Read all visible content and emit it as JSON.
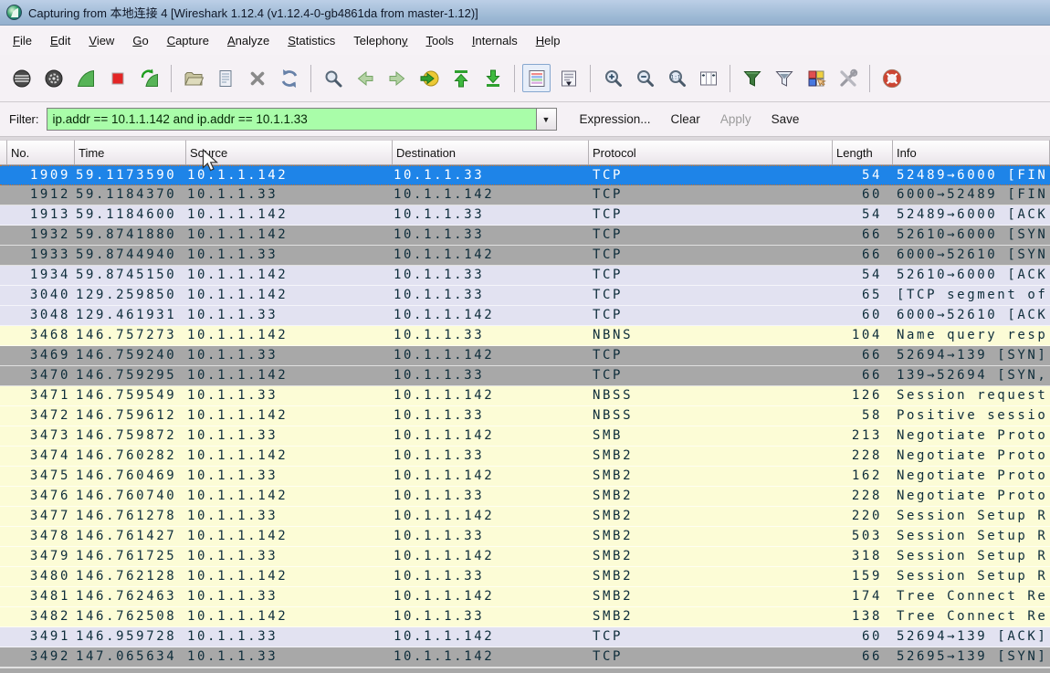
{
  "window": {
    "title": "Capturing from 本地连接 4    [Wireshark 1.12.4  (v1.12.4-0-gb4861da from master-1.12)]",
    "app_icon": "wireshark-logo"
  },
  "menubar": {
    "items": [
      {
        "label": "File",
        "underline": 0
      },
      {
        "label": "Edit",
        "underline": 0
      },
      {
        "label": "View",
        "underline": 0
      },
      {
        "label": "Go",
        "underline": 0
      },
      {
        "label": "Capture",
        "underline": 0
      },
      {
        "label": "Analyze",
        "underline": 0
      },
      {
        "label": "Statistics",
        "underline": 0
      },
      {
        "label": "Telephony",
        "underline": 8
      },
      {
        "label": "Tools",
        "underline": 0
      },
      {
        "label": "Internals",
        "underline": 0
      },
      {
        "label": "Help",
        "underline": 0
      }
    ]
  },
  "toolbar": {
    "groups": [
      [
        "interface-list",
        "capture-options",
        "capture-start",
        "capture-stop",
        "capture-restart"
      ],
      [
        "file-open",
        "file-save",
        "file-close",
        "reload"
      ],
      [
        "find-packet",
        "go-back",
        "go-forward",
        "go-to-packet",
        "go-to-top",
        "go-to-bottom"
      ],
      [
        "colorize",
        "auto-scroll"
      ],
      [
        "zoom-in",
        "zoom-out",
        "zoom-actual",
        "resize-columns"
      ],
      [
        "capture-filters",
        "display-filters",
        "coloring-rules",
        "preferences"
      ],
      [
        "help"
      ]
    ],
    "active_tool": "colorize"
  },
  "filter_bar": {
    "label": "Filter:",
    "value": "ip.addr == 10.1.1.142 and ip.addr == 10.1.1.33",
    "buttons": [
      {
        "label": "Expression...",
        "enabled": true
      },
      {
        "label": "Clear",
        "enabled": true
      },
      {
        "label": "Apply",
        "enabled": false
      },
      {
        "label": "Save",
        "enabled": true
      }
    ]
  },
  "packet_list": {
    "columns": [
      "No.",
      "Time",
      "Source",
      "Destination",
      "Protocol",
      "Length",
      "Info"
    ],
    "rows": [
      {
        "no": "1909",
        "time": "59.1173590",
        "source": "10.1.1.142",
        "destination": "10.1.1.33",
        "protocol": "TCP",
        "length": "54",
        "info": "52489→6000 [FIN",
        "color": "selected"
      },
      {
        "no": "1912",
        "time": "59.1184370",
        "source": "10.1.1.33",
        "destination": "10.1.1.142",
        "protocol": "TCP",
        "length": "60",
        "info": "6000→52489 [FIN",
        "color": "gray"
      },
      {
        "no": "1913",
        "time": "59.1184600",
        "source": "10.1.1.142",
        "destination": "10.1.1.33",
        "protocol": "TCP",
        "length": "54",
        "info": "52489→6000 [ACK",
        "color": "lavender"
      },
      {
        "no": "1932",
        "time": "59.8741880",
        "source": "10.1.1.142",
        "destination": "10.1.1.33",
        "protocol": "TCP",
        "length": "66",
        "info": "52610→6000 [SYN",
        "color": "gray"
      },
      {
        "no": "1933",
        "time": "59.8744940",
        "source": "10.1.1.33",
        "destination": "10.1.1.142",
        "protocol": "TCP",
        "length": "66",
        "info": "6000→52610 [SYN",
        "color": "gray"
      },
      {
        "no": "1934",
        "time": "59.8745150",
        "source": "10.1.1.142",
        "destination": "10.1.1.33",
        "protocol": "TCP",
        "length": "54",
        "info": "52610→6000 [ACK",
        "color": "lavender"
      },
      {
        "no": "3040",
        "time": "129.259850",
        "source": "10.1.1.142",
        "destination": "10.1.1.33",
        "protocol": "TCP",
        "length": "65",
        "info": "[TCP segment of",
        "color": "lavender"
      },
      {
        "no": "3048",
        "time": "129.461931",
        "source": "10.1.1.33",
        "destination": "10.1.1.142",
        "protocol": "TCP",
        "length": "60",
        "info": "6000→52610 [ACK",
        "color": "lavender"
      },
      {
        "no": "3468",
        "time": "146.757273",
        "source": "10.1.1.142",
        "destination": "10.1.1.33",
        "protocol": "NBNS",
        "length": "104",
        "info": "Name query resp",
        "color": "yellow"
      },
      {
        "no": "3469",
        "time": "146.759240",
        "source": "10.1.1.33",
        "destination": "10.1.1.142",
        "protocol": "TCP",
        "length": "66",
        "info": "52694→139 [SYN]",
        "color": "gray"
      },
      {
        "no": "3470",
        "time": "146.759295",
        "source": "10.1.1.142",
        "destination": "10.1.1.33",
        "protocol": "TCP",
        "length": "66",
        "info": "139→52694 [SYN,",
        "color": "gray"
      },
      {
        "no": "3471",
        "time": "146.759549",
        "source": "10.1.1.33",
        "destination": "10.1.1.142",
        "protocol": "NBSS",
        "length": "126",
        "info": "Session request",
        "color": "yellow"
      },
      {
        "no": "3472",
        "time": "146.759612",
        "source": "10.1.1.142",
        "destination": "10.1.1.33",
        "protocol": "NBSS",
        "length": "58",
        "info": "Positive sessio",
        "color": "yellow"
      },
      {
        "no": "3473",
        "time": "146.759872",
        "source": "10.1.1.33",
        "destination": "10.1.1.142",
        "protocol": "SMB",
        "length": "213",
        "info": "Negotiate Proto",
        "color": "yellow"
      },
      {
        "no": "3474",
        "time": "146.760282",
        "source": "10.1.1.142",
        "destination": "10.1.1.33",
        "protocol": "SMB2",
        "length": "228",
        "info": "Negotiate Proto",
        "color": "yellow"
      },
      {
        "no": "3475",
        "time": "146.760469",
        "source": "10.1.1.33",
        "destination": "10.1.1.142",
        "protocol": "SMB2",
        "length": "162",
        "info": "Negotiate Proto",
        "color": "yellow"
      },
      {
        "no": "3476",
        "time": "146.760740",
        "source": "10.1.1.142",
        "destination": "10.1.1.33",
        "protocol": "SMB2",
        "length": "228",
        "info": "Negotiate Proto",
        "color": "yellow"
      },
      {
        "no": "3477",
        "time": "146.761278",
        "source": "10.1.1.33",
        "destination": "10.1.1.142",
        "protocol": "SMB2",
        "length": "220",
        "info": "Session Setup R",
        "color": "yellow"
      },
      {
        "no": "3478",
        "time": "146.761427",
        "source": "10.1.1.142",
        "destination": "10.1.1.33",
        "protocol": "SMB2",
        "length": "503",
        "info": "Session Setup R",
        "color": "yellow"
      },
      {
        "no": "3479",
        "time": "146.761725",
        "source": "10.1.1.33",
        "destination": "10.1.1.142",
        "protocol": "SMB2",
        "length": "318",
        "info": "Session Setup R",
        "color": "yellow"
      },
      {
        "no": "3480",
        "time": "146.762128",
        "source": "10.1.1.142",
        "destination": "10.1.1.33",
        "protocol": "SMB2",
        "length": "159",
        "info": "Session Setup R",
        "color": "yellow"
      },
      {
        "no": "3481",
        "time": "146.762463",
        "source": "10.1.1.33",
        "destination": "10.1.1.142",
        "protocol": "SMB2",
        "length": "174",
        "info": "Tree Connect Re",
        "color": "yellow"
      },
      {
        "no": "3482",
        "time": "146.762508",
        "source": "10.1.1.142",
        "destination": "10.1.1.33",
        "protocol": "SMB2",
        "length": "138",
        "info": "Tree Connect Re",
        "color": "yellow"
      },
      {
        "no": "3491",
        "time": "146.959728",
        "source": "10.1.1.33",
        "destination": "10.1.1.142",
        "protocol": "TCP",
        "length": "60",
        "info": "52694→139 [ACK]",
        "color": "lavender"
      },
      {
        "no": "3492",
        "time": "147.065634",
        "source": "10.1.1.33",
        "destination": "10.1.1.142",
        "protocol": "TCP",
        "length": "66",
        "info": "52695→139 [SYN]",
        "color": "gray"
      }
    ]
  },
  "colors": {
    "titlebar": "#9cb8d4",
    "filter_input_bg": "#a9fda9",
    "row_selected": "#1e84e8",
    "row_gray": "#a8a8a8",
    "row_lavender": "#e2e2f1",
    "row_yellow": "#fcfcd6",
    "selection_focus_dots": "#cc7020"
  }
}
